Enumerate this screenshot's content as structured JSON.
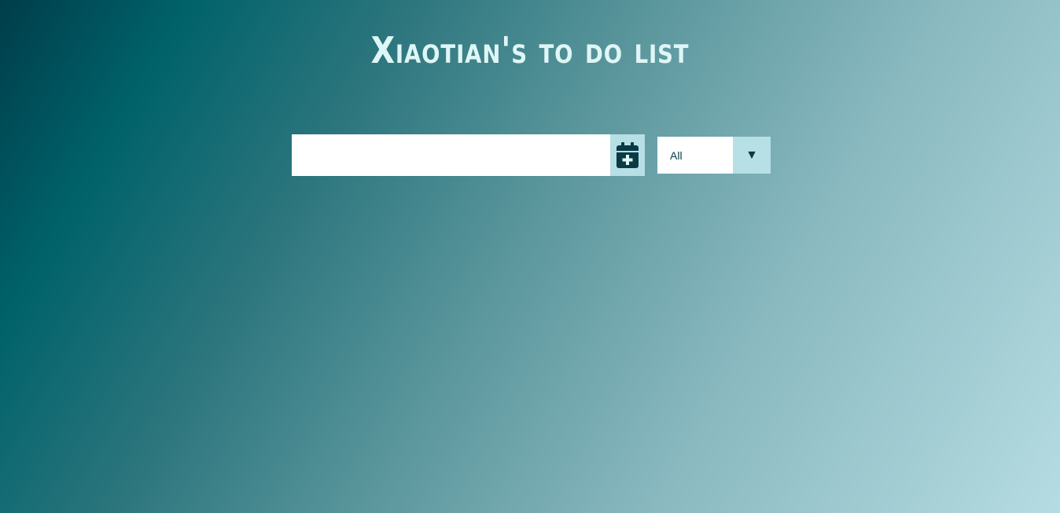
{
  "header": {
    "title": "Xiaotian's to do list"
  },
  "todo_form": {
    "input_value": "",
    "input_placeholder": "",
    "add_button_icon": "calendar-plus-icon"
  },
  "filter": {
    "selected": "All",
    "arrow_glyph": "▼"
  },
  "colors": {
    "gradient_start": "#003d4a",
    "gradient_end": "#b5dce2",
    "title": "#dff6f6",
    "accent": "#b7dfe6",
    "icon": "#0a3a44"
  }
}
